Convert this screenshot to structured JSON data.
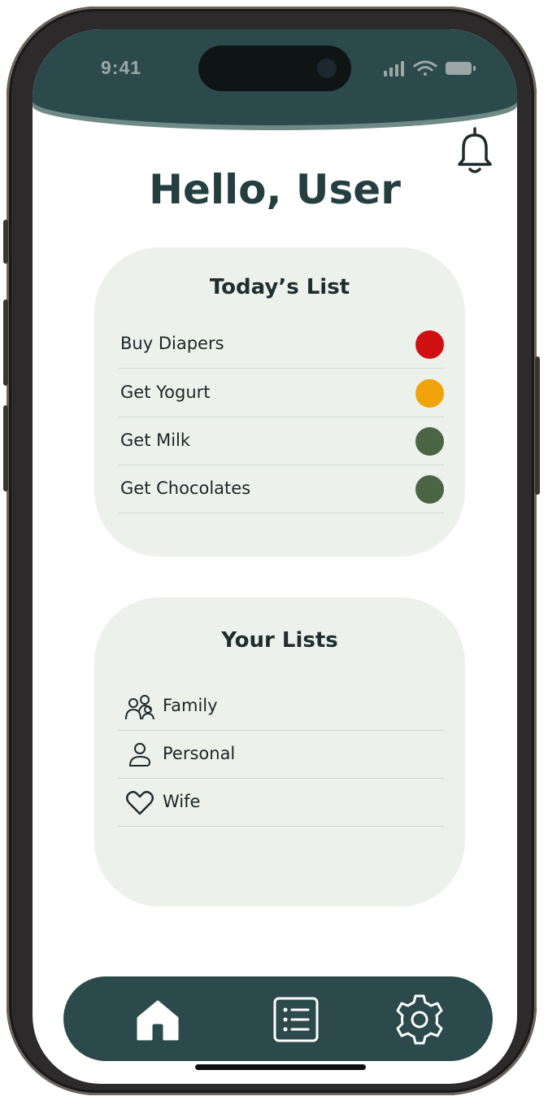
{
  "status_bar": {
    "time": "9:41"
  },
  "header": {
    "greeting": "Hello, User",
    "notification_icon": "bell-icon"
  },
  "today_list": {
    "title": "Today’s List",
    "items": [
      {
        "label": "Buy Diapers",
        "status_color": "#d01010"
      },
      {
        "label": "Get Yogurt",
        "status_color": "#f0a30a"
      },
      {
        "label": "Get Milk",
        "status_color": "#4b6544"
      },
      {
        "label": "Get Chocolates",
        "status_color": "#4b6544"
      }
    ]
  },
  "your_lists": {
    "title": "Your Lists",
    "items": [
      {
        "label": "Family",
        "icon": "family-icon"
      },
      {
        "label": "Personal",
        "icon": "person-icon"
      },
      {
        "label": "Wife",
        "icon": "heart-icon"
      }
    ]
  },
  "bottom_nav": {
    "items": [
      {
        "icon": "home-icon"
      },
      {
        "icon": "list-icon"
      },
      {
        "icon": "gear-icon"
      }
    ]
  },
  "colors": {
    "primary": "#2c4a4c",
    "card_background": "#ecf1ec",
    "heading": "#253f41"
  }
}
